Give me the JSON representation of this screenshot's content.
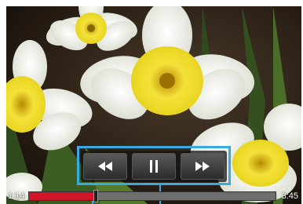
{
  "player": {
    "current_time": "1:14",
    "total_time": "3:45",
    "progress_fraction": 0.27,
    "accent_color": "#d0152a",
    "highlight_color": "#39a9e0"
  },
  "controls": {
    "rewind_icon": "rewind-icon",
    "pause_icon": "pause-icon",
    "fast_forward_icon": "fast-forward-icon"
  }
}
